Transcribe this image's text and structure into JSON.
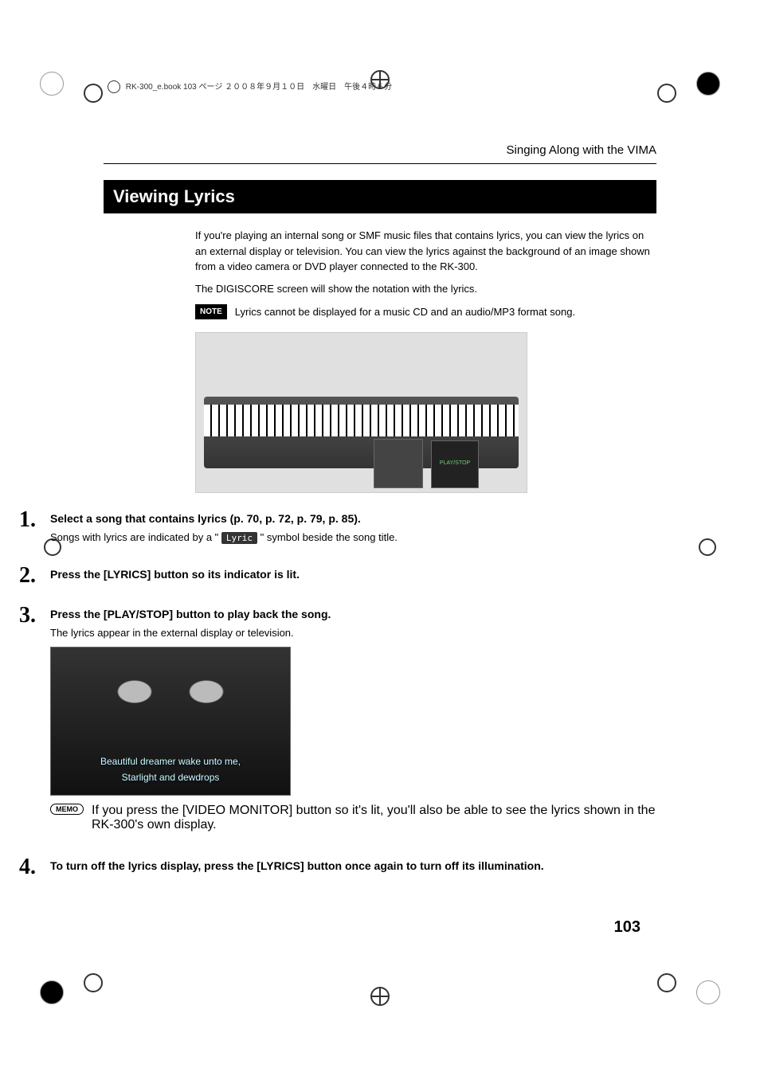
{
  "header_ref": "RK-300_e.book  103 ページ  ２００８年９月１０日　水曜日　午後４時６分",
  "chapter_title": "Singing Along with the VIMA",
  "section_title": "Viewing Lyrics",
  "intro": {
    "p1": "If you're playing an internal song or SMF music files that contains lyrics, you can view the lyrics on an external display or television. You can view the lyrics against the background of an image shown from a video camera or DVD player connected to the RK-300.",
    "p2": "The DIGISCORE screen will show the notation with the lyrics."
  },
  "note_label": "NOTE",
  "note_text": "Lyrics cannot be displayed for a music CD and an audio/MP3 format song.",
  "kbd_callout": "PLAY/STOP",
  "steps": [
    {
      "num": "1.",
      "title": "Select a song that contains lyrics (p. 70, p. 72, p. 79, p. 85).",
      "text_before": "Songs with lyrics are indicated by a \"",
      "lyric_badge": "Lyric",
      "text_after": "\" symbol beside the song title."
    },
    {
      "num": "2.",
      "title": "Press the [LYRICS] button so its indicator is lit."
    },
    {
      "num": "3.",
      "title": "Press the [PLAY/STOP] button to play back the song.",
      "text": "The lyrics appear in the external display or television.",
      "screen_line1": "Beautiful dreamer wake unto me,",
      "screen_line2": "Starlight and dewdrops",
      "memo_label": "MEMO",
      "memo_text": "If you press the [VIDEO MONITOR] button so it's lit, you'll also be able to see the lyrics shown in the RK-300's own display."
    },
    {
      "num": "4.",
      "title": "To turn off the lyrics display, press the [LYRICS] button once again to turn off its illumination."
    }
  ],
  "page_number": "103"
}
